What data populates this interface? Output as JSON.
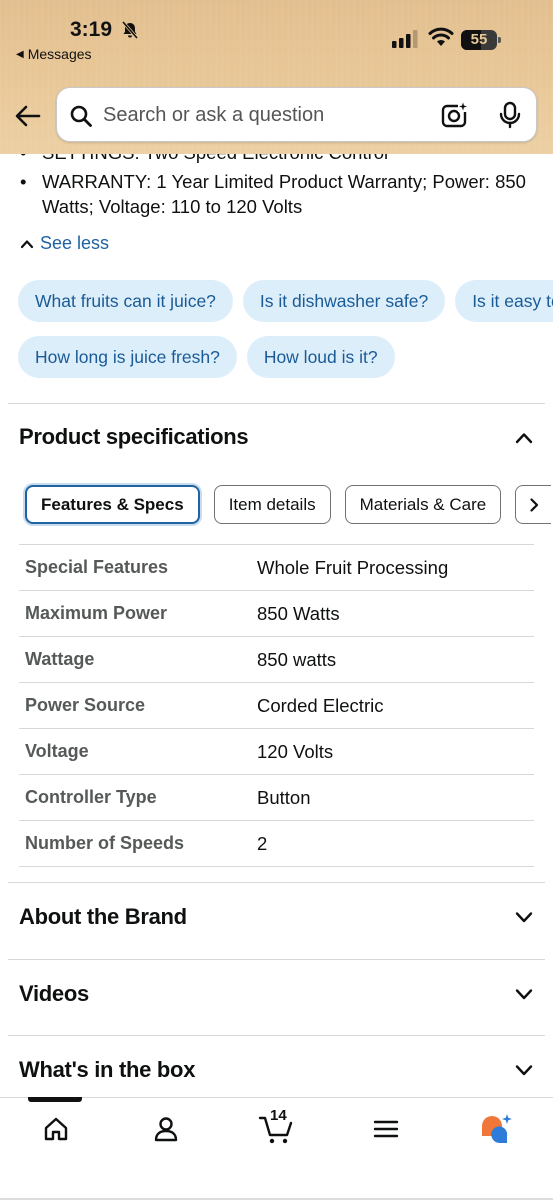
{
  "status_bar": {
    "time": "3:19",
    "back_app": "Messages",
    "battery": "55"
  },
  "search": {
    "placeholder": "Search or ask a question"
  },
  "bullets": [
    "SETTINGS: Two Speed Electronic Control",
    "WARRANTY: 1 Year Limited Product Warranty; Power: 850 Watts; Voltage: 110 to 120 Volts"
  ],
  "see_less": "See less",
  "questions": {
    "row1": [
      "What fruits can it juice?",
      "Is it dishwasher safe?",
      "Is it easy to clean?"
    ],
    "row2": [
      "How long is juice fresh?",
      "How loud is it?"
    ]
  },
  "specs_section": {
    "title": "Product specifications",
    "tabs": [
      "Features & Specs",
      "Item details",
      "Materials & Care"
    ],
    "rows": [
      {
        "label": "Special Features",
        "value": "Whole Fruit Processing"
      },
      {
        "label": "Maximum Power",
        "value": "850 Watts"
      },
      {
        "label": "Wattage",
        "value": "850 watts"
      },
      {
        "label": "Power Source",
        "value": "Corded Electric"
      },
      {
        "label": "Voltage",
        "value": "120 Volts"
      },
      {
        "label": "Controller Type",
        "value": "Button"
      },
      {
        "label": "Number of Speeds",
        "value": "2"
      }
    ]
  },
  "sections": {
    "about_brand": "About the Brand",
    "videos": "Videos",
    "whats_in_box": "What's in the box"
  },
  "bottom_nav": {
    "cart_count": "14",
    "items": [
      "home-icon",
      "account-icon",
      "cart-icon",
      "menu-icon",
      "rufus-assistant-icon"
    ]
  },
  "colors": {
    "header": "#e9c898",
    "link": "#2162a1",
    "chip_bg": "#ddeefb",
    "chip_text": "#1a5b96",
    "assistant_orange": "#f0773a",
    "assistant_blue": "#2f7bd8"
  }
}
